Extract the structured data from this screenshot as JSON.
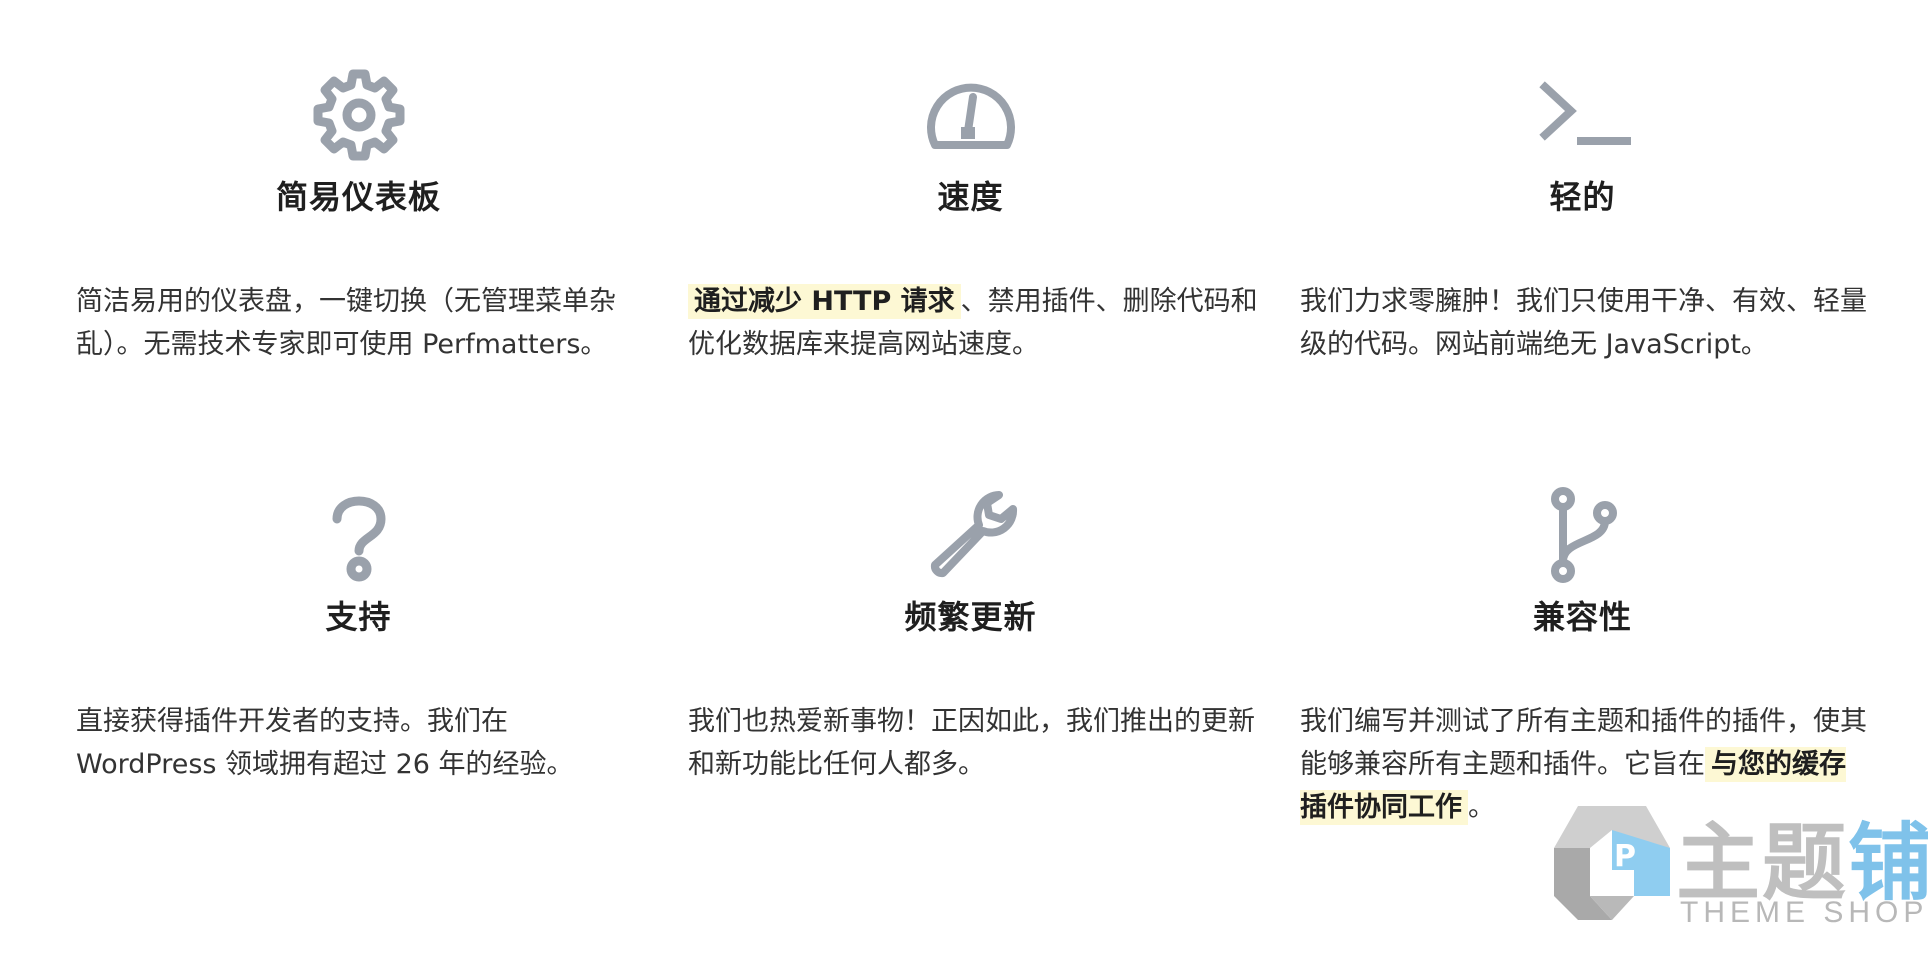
{
  "features": [
    {
      "icon": "gear-icon",
      "title": "简易仪表板",
      "desc_prefix": "",
      "highlight": "",
      "desc_suffix": "简洁易用的仪表盘，一键切换（无管理菜单杂乱）。无需技术专家即可使用 Perfmatters。"
    },
    {
      "icon": "speedometer-icon",
      "title": "速度",
      "desc_prefix": "",
      "highlight": "通过减少 HTTP 请求",
      "desc_suffix": "、禁用插件、删除代码和优化数据库来提高网站速度。"
    },
    {
      "icon": "terminal-icon",
      "title": "轻的",
      "desc_prefix": "",
      "highlight": "",
      "desc_suffix": "我们力求零臃肿！我们只使用干净、有效、轻量级的代码。网站前端绝无 JavaScript。"
    },
    {
      "icon": "question-mark-icon",
      "title": "支持",
      "desc_prefix": "",
      "highlight": "",
      "desc_suffix": "直接获得插件开发者的支持。我们在 WordPress 领域拥有超过 26 年的经验。"
    },
    {
      "icon": "wrench-icon",
      "title": "频繁更新",
      "desc_prefix": "",
      "highlight": "",
      "desc_suffix": "我们也热爱新事物！正因如此，我们推出的更新和新功能比任何人都多。"
    },
    {
      "icon": "git-branch-icon",
      "title": "兼容性",
      "desc_prefix": "我们编写并测试了所有主题和插件的插件，使其能够兼容所有主题和插件。它旨在",
      "highlight": "与您的缓存插件协同工作",
      "desc_suffix": "。"
    }
  ],
  "colors": {
    "icon": "#9aa1ab",
    "highlight_bg": "#fdf8d4",
    "title": "#1f1f1f",
    "text": "#333333"
  },
  "watermark": {
    "cn_part1": "主题",
    "cn_part2": "铺",
    "en": "THEME SHOP",
    "icon": "theme-shop-logo-icon"
  }
}
